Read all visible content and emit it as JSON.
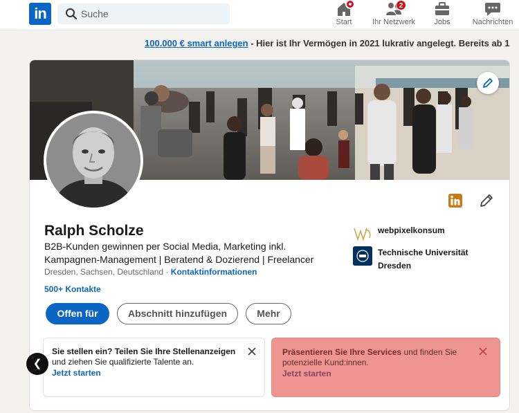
{
  "nav": {
    "logo_text": "in",
    "search_placeholder": "Suche",
    "items": [
      {
        "label": "Start",
        "icon": "home-icon",
        "badge": ""
      },
      {
        "label": "Ihr Netzwerk",
        "icon": "network-icon",
        "badge": "2"
      },
      {
        "label": "Jobs",
        "icon": "briefcase-icon",
        "badge": ""
      },
      {
        "label": "Nachrichten",
        "icon": "messages-icon",
        "badge": ""
      }
    ]
  },
  "ad": {
    "link_text": "100.000 € smart anlegen",
    "separator": " - ",
    "text": "Hier ist Ihr Vermögen in 2021 lukrativ angelegt. Bereits ab 1"
  },
  "profile": {
    "name": "Ralph Scholze",
    "headline": "B2B-Kunden gewinnen per Social Media, Marketing inkl. Kampagnen-Management | Beratend & Dozierend | Freelancer",
    "location": "Dresden, Sachsen, Deutschland",
    "location_separator": " · ",
    "contact_info_label": "Kontaktinformationen",
    "connections": "500+ Kontakte",
    "orgs": [
      {
        "name": "webpixelkonsum",
        "icon": "webpixelkonsum-logo-icon"
      },
      {
        "name": "Technische Universität Dresden",
        "icon": "tu-dresden-logo-icon"
      }
    ]
  },
  "actions": {
    "open_to": "Offen für",
    "add_section": "Abschnitt hinzufügen",
    "more": "Mehr"
  },
  "promos": [
    {
      "title": "Sie stellen ein? Teilen Sie Ihre Stellenanzeigen",
      "body": " und ziehen Sie qualifizierte Talente an.",
      "cta": "Jetzt starten"
    },
    {
      "title": "Präsentieren Sie Ihre Services",
      "body": " und finden Sie potenzielle Kund:innen.",
      "cta": "Jetzt starten"
    }
  ],
  "colors": {
    "brand": "#0a66c2",
    "badge": "#cc1016",
    "promo_highlight": "#ee9591",
    "premium_gold": "#c37d16"
  }
}
